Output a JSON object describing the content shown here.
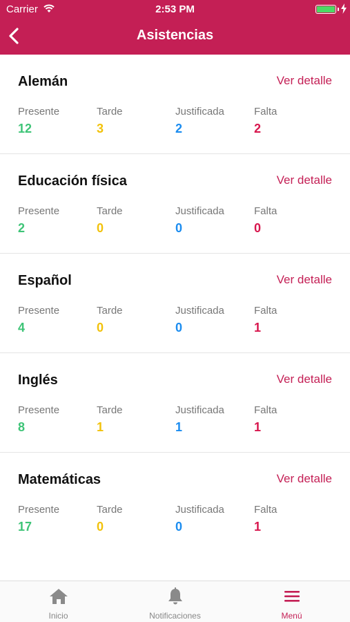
{
  "status": {
    "carrier": "Carrier",
    "time": "2:53 PM",
    "battery_level": 1.0
  },
  "header": {
    "title": "Asistencias"
  },
  "link_label": "Ver detalle",
  "stat_labels": {
    "presente": "Presente",
    "tarde": "Tarde",
    "justificada": "Justificada",
    "falta": "Falta"
  },
  "colors": {
    "accent": "#c41f55",
    "presente": "#3ec477",
    "tarde": "#f2c20c",
    "justificada": "#1a8cf0",
    "falta": "#d8174e"
  },
  "subjects": [
    {
      "name": "Alemán",
      "presente": "12",
      "tarde": "3",
      "justificada": "2",
      "falta": "2"
    },
    {
      "name": "Educación física",
      "presente": "2",
      "tarde": "0",
      "justificada": "0",
      "falta": "0"
    },
    {
      "name": "Español",
      "presente": "4",
      "tarde": "0",
      "justificada": "0",
      "falta": "1"
    },
    {
      "name": "Inglés",
      "presente": "8",
      "tarde": "1",
      "justificada": "1",
      "falta": "1"
    },
    {
      "name": "Matemáticas",
      "presente": "17",
      "tarde": "0",
      "justificada": "0",
      "falta": "1"
    }
  ],
  "tabs": [
    {
      "label": "Inicio",
      "icon": "home-icon"
    },
    {
      "label": "Notificaciones",
      "icon": "bell-icon"
    },
    {
      "label": "Menú",
      "icon": "menu-icon",
      "active": true
    }
  ]
}
